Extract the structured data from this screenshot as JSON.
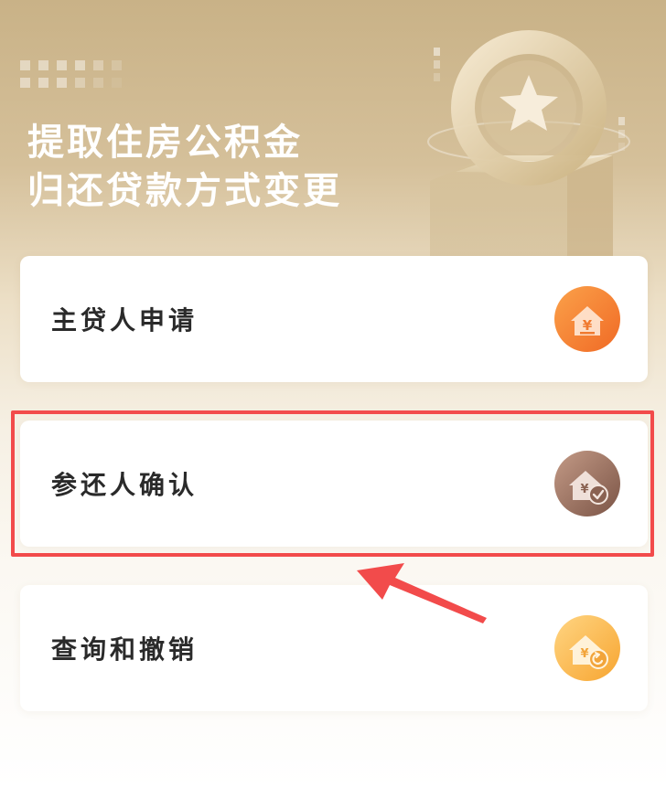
{
  "banner": {
    "title_line1": "提取住房公积金",
    "title_line2": "归还贷款方式变更"
  },
  "options": [
    {
      "label": "主贷人申请",
      "icon": "house-yuan-icon",
      "color": "#f58431"
    },
    {
      "label": "参还人确认",
      "icon": "house-yuan-check-icon",
      "color": "#9a6f5d",
      "highlighted": true
    },
    {
      "label": "查询和撤销",
      "icon": "house-yuan-undo-icon",
      "color": "#fbb242"
    }
  ],
  "colors": {
    "banner_gold": "#c9b287",
    "highlight_red": "#f24b4b"
  }
}
